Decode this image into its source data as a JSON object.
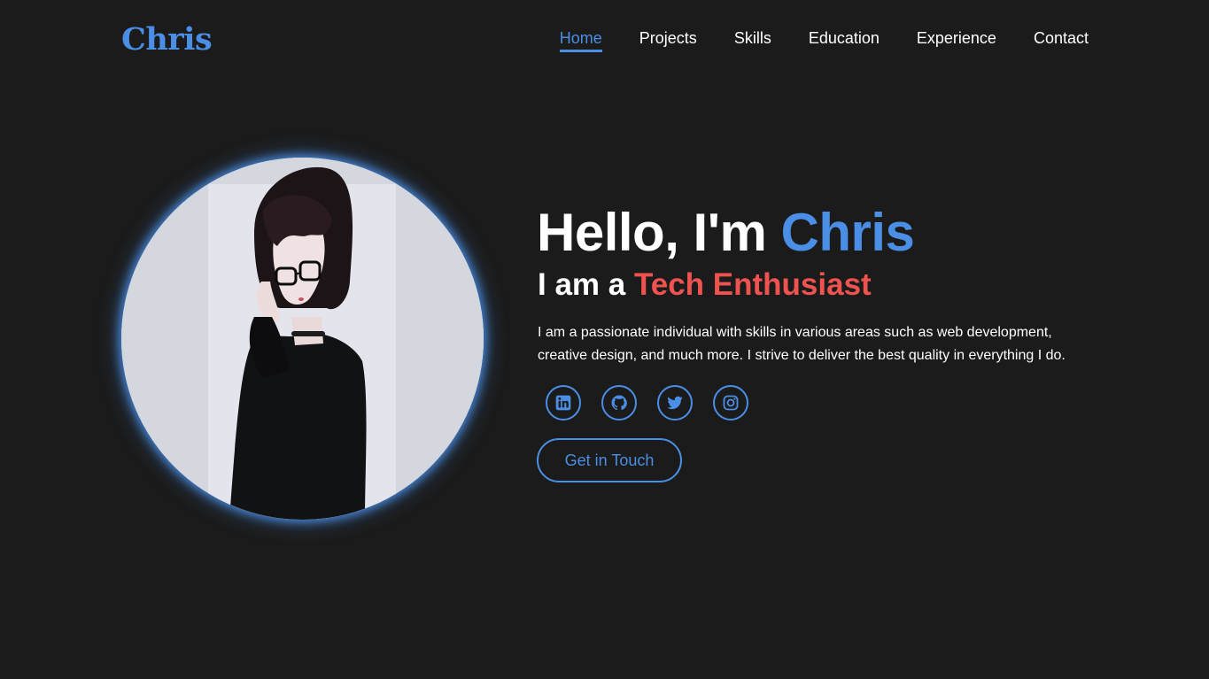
{
  "brand": {
    "logo": "Chris"
  },
  "nav": {
    "items": [
      {
        "label": "Home",
        "active": true
      },
      {
        "label": "Projects",
        "active": false
      },
      {
        "label": "Skills",
        "active": false
      },
      {
        "label": "Education",
        "active": false
      },
      {
        "label": "Experience",
        "active": false
      },
      {
        "label": "Contact",
        "active": false
      }
    ]
  },
  "hero": {
    "greeting": "Hello, I'm",
    "name": "Chris",
    "subtitle_prefix": "I am a",
    "role": "Tech Enthusiast",
    "description": "I am a passionate individual with skills in various areas such as web development, creative design, and much more. I strive to deliver the best quality in everything I do.",
    "avatar_icon": "anime-portrait-avatar"
  },
  "social": [
    {
      "icon": "linkedin-icon"
    },
    {
      "icon": "github-icon"
    },
    {
      "icon": "twitter-icon"
    },
    {
      "icon": "instagram-icon"
    }
  ],
  "cta": {
    "label": "Get in Touch"
  },
  "colors": {
    "background": "#1b1b1b",
    "accent": "#4a8ee6",
    "highlight": "#ef5350",
    "text": "#ffffff"
  }
}
